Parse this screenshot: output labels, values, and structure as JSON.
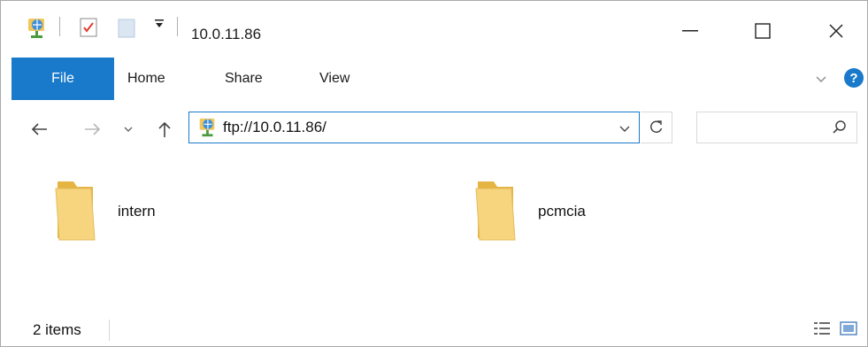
{
  "window": {
    "title": "10.0.11.86",
    "icons": [
      "network-drive-icon",
      "properties-icon",
      "new-folder-icon",
      "customize-qa-dropdown-icon",
      "minimize-icon",
      "maximize-icon",
      "close-icon"
    ]
  },
  "ribbon": {
    "tabs": [
      {
        "label": "File",
        "active": true
      },
      {
        "label": "Home"
      },
      {
        "label": "Share"
      },
      {
        "label": "View"
      }
    ],
    "icons": [
      "expand-ribbon-icon",
      "help-icon"
    ]
  },
  "navigation": {
    "address": "ftp://10.0.11.86/",
    "search_placeholder": "",
    "icons": [
      "back-arrow-icon",
      "forward-arrow-icon",
      "recent-dropdown-icon",
      "up-arrow-icon",
      "refresh-icon",
      "search-icon"
    ]
  },
  "content": {
    "items": [
      {
        "name": "intern",
        "type": "folder"
      },
      {
        "name": "pcmcia",
        "type": "folder"
      }
    ]
  },
  "status": {
    "item_count": "2 items",
    "view_icons": [
      "details-view-icon",
      "large-icons-view-icon"
    ]
  },
  "colors": {
    "accent": "#1979ca",
    "folder": "#f3cb6a",
    "help_circle": "#1979ca"
  }
}
